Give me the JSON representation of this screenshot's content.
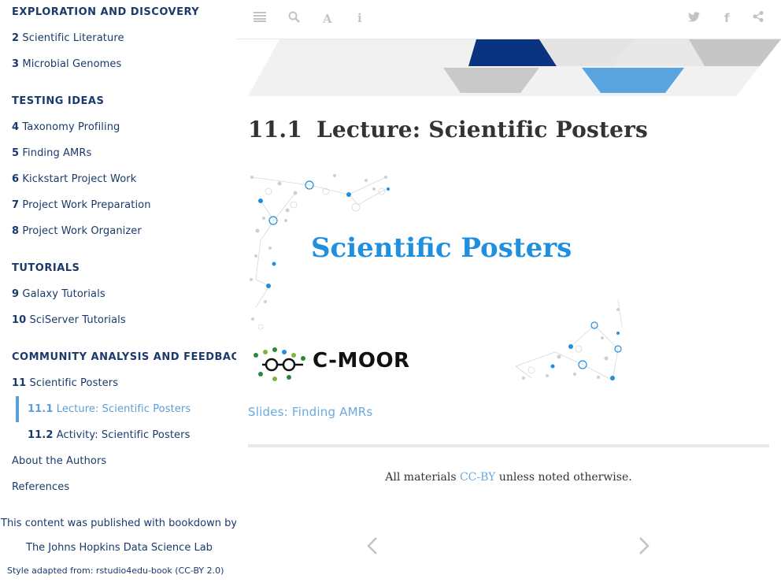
{
  "sidebar": {
    "section_exploration": "EXPLORATION AND DISCOVERY",
    "items_exploration": [
      {
        "num": "2",
        "label": "Scientific Literature"
      },
      {
        "num": "3",
        "label": "Microbial Genomes"
      }
    ],
    "section_testing": "TESTING IDEAS",
    "items_testing": [
      {
        "num": "4",
        "label": "Taxonomy Profiling"
      },
      {
        "num": "5",
        "label": "Finding AMRs"
      },
      {
        "num": "6",
        "label": "Kickstart Project Work"
      },
      {
        "num": "7",
        "label": "Project Work Preparation"
      },
      {
        "num": "8",
        "label": "Project Work Organizer"
      }
    ],
    "section_tutorials": "TUTORIALS",
    "items_tutorials": [
      {
        "num": "9",
        "label": "Galaxy Tutorials"
      },
      {
        "num": "10",
        "label": "SciServer Tutorials"
      }
    ],
    "section_community": "COMMUNITY ANALYSIS AND FEEDBACK",
    "items_community": [
      {
        "num": "11",
        "label": "Scientific Posters"
      },
      {
        "num": "11.1",
        "label": "Lecture: Scientific Posters"
      },
      {
        "num": "11.2",
        "label": "Activity: Scientific Posters"
      }
    ],
    "about": "About the Authors",
    "references": "References",
    "published_with": "This content was published with bookdown by:",
    "publisher": "The Johns Hopkins Data Science Lab",
    "style_note": "Style adapted from: rstudio4edu-book (CC-BY 2.0)"
  },
  "toolbar": {
    "icons": [
      "menu-icon",
      "search-icon",
      "font-icon",
      "info-icon",
      "twitter-icon",
      "facebook-icon",
      "share-icon"
    ]
  },
  "main": {
    "section_num": "11.1",
    "title": "Lecture: Scientific Posters",
    "slide_title": "Scientific Posters",
    "slide_logo": "C-MOOR",
    "slides_link": "Slides: Finding AMRs",
    "footer_prefix": "All materials",
    "footer_link": "CC-BY",
    "footer_suffix": "unless noted otherwise."
  },
  "colors": {
    "accent": "#5a9fd8",
    "nav_text": "#1a3a6b",
    "banner_dark": "#0a3380",
    "banner_light": "#5aa4e0",
    "slide_title": "#1f8fe0"
  }
}
